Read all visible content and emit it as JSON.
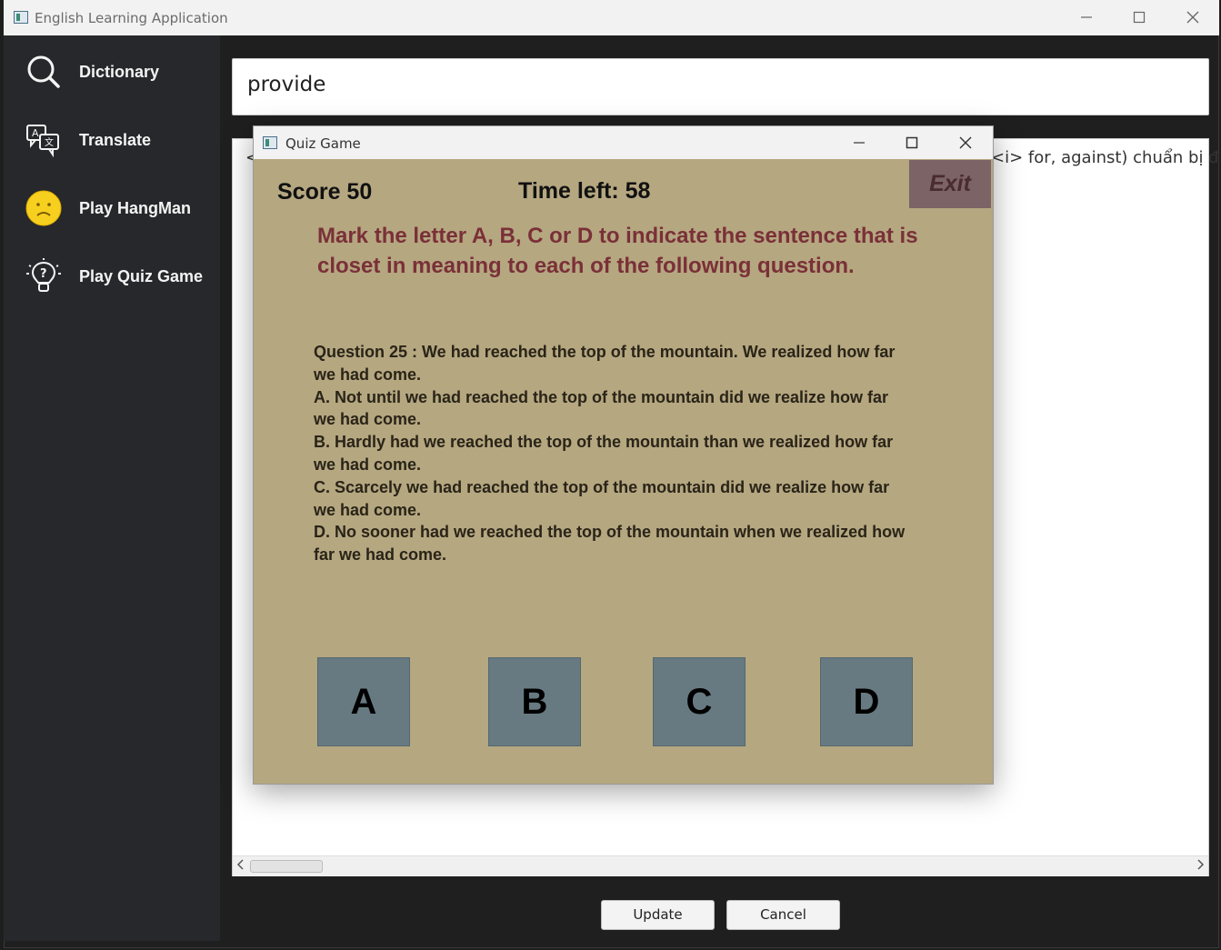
{
  "app": {
    "title": "English Learning Application"
  },
  "sidebar": {
    "items": [
      {
        "label": "Dictionary",
        "icon": "search-icon"
      },
      {
        "label": "Translate",
        "icon": "translate-icon"
      },
      {
        "label": "Play HangMan",
        "icon": "sad-face-icon"
      },
      {
        "label": "Play Quiz Game",
        "icon": "lightbulb-question-icon"
      }
    ]
  },
  "search": {
    "value": "provide"
  },
  "definition": {
    "text_left": "<",
    "text_right": "<i> for,  against) chuẩn bị đ"
  },
  "buttons": {
    "update": "Update",
    "cancel": "Cancel"
  },
  "quiz": {
    "title": "Quiz Game",
    "score": "Score 50",
    "time_left": "Time left: 58",
    "exit_label": "Exit",
    "instruction": "Mark the letter A, B, C or D to indicate the sentence that is closet in meaning to each of the following question.",
    "question_lines": [
      "Question 25 : We had reached the top of the mountain. We realized how far",
      "we had come.",
      "A. Not until we had reached the top of the mountain did we realize how far",
      "we had come.",
      "B. Hardly had we reached the top of the mountain than we realized how far",
      "we had come.",
      "C. Scarcely we had reached the top of the mountain did we realize how far",
      "we had come.",
      "D. No sooner had we reached the top of the mountain when we realized how",
      "far we had come."
    ],
    "answers": [
      "A",
      "B",
      "C",
      "D"
    ]
  },
  "colors": {
    "sidebar_bg": "#27282c",
    "quiz_bg": "#b5a780",
    "instruction_text": "#7a3038",
    "answer_button": "#677a82",
    "exit_button": "#7b6366"
  }
}
